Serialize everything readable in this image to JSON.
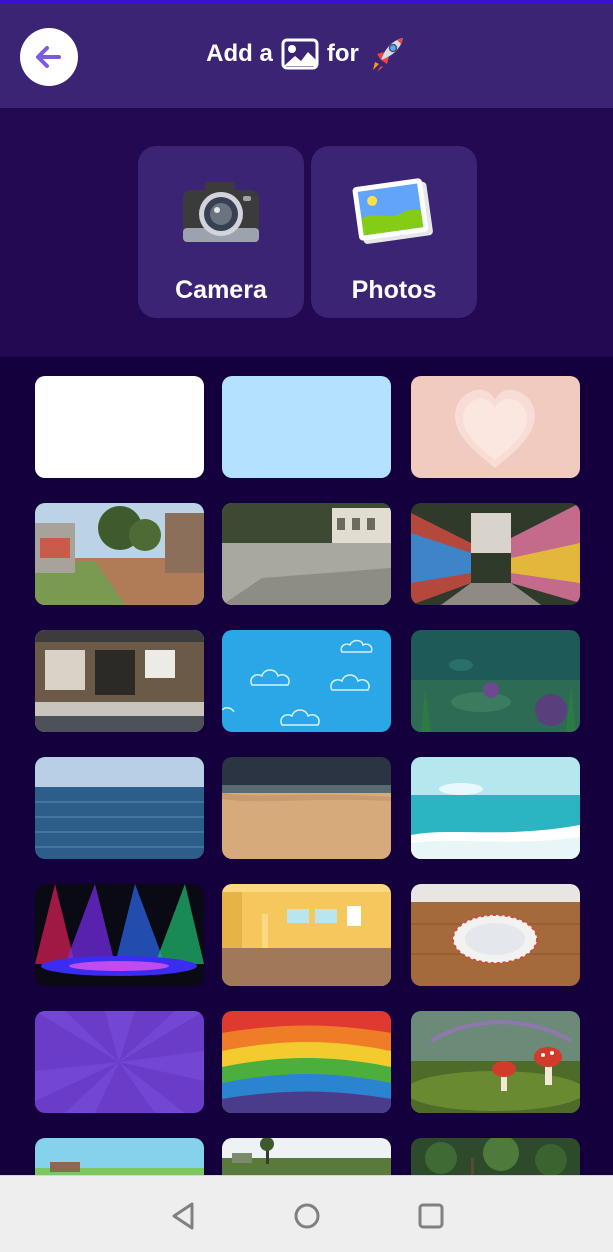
{
  "header": {
    "title_prefix": "Add a",
    "title_mid": "for",
    "back_icon": "arrow-left-icon",
    "image_icon": "image-icon",
    "rocket_icon": "rocket-emoji-icon"
  },
  "sources": [
    {
      "label": "Camera",
      "icon": "camera-icon"
    },
    {
      "label": "Photos",
      "icon": "photos-icon"
    }
  ],
  "backgrounds": [
    {
      "name": "white"
    },
    {
      "name": "light-blue"
    },
    {
      "name": "pink-heart"
    },
    {
      "name": "village-street"
    },
    {
      "name": "plaza"
    },
    {
      "name": "graffiti-alley"
    },
    {
      "name": "japanese-storefront"
    },
    {
      "name": "cloud-drawing"
    },
    {
      "name": "underwater"
    },
    {
      "name": "ocean"
    },
    {
      "name": "beach-sand"
    },
    {
      "name": "cartoon-beach"
    },
    {
      "name": "stage-lights"
    },
    {
      "name": "room"
    },
    {
      "name": "plate-on-table"
    },
    {
      "name": "purple-rays"
    },
    {
      "name": "rainbow"
    },
    {
      "name": "mushrooms"
    },
    {
      "name": "field"
    },
    {
      "name": "palm-trees"
    },
    {
      "name": "jungle"
    }
  ],
  "nav": [
    "back-triangle-icon",
    "home-circle-icon",
    "recents-square-icon"
  ],
  "colors": {
    "header_bg": "#3b2474",
    "source_section_bg": "#230852",
    "grid_bg": "#14003c",
    "accent": "#7b5be0"
  }
}
